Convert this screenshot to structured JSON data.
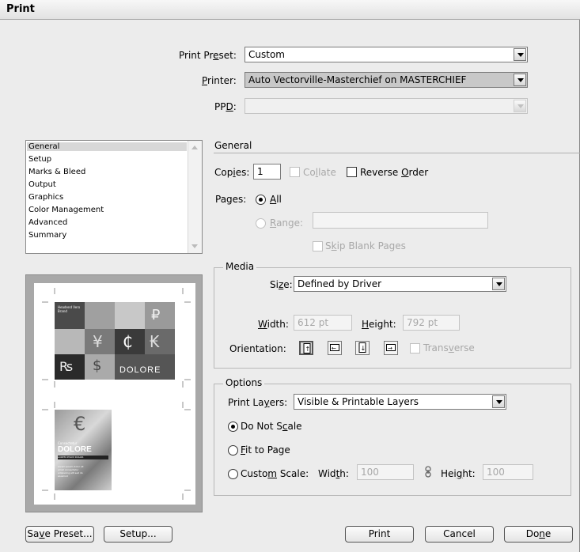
{
  "window": {
    "title": "Print"
  },
  "preset": {
    "label_pre": "Print Pr",
    "label_key": "e",
    "label_post": "set:",
    "value": "Custom"
  },
  "printer": {
    "label_key": "P",
    "label_post": "rinter:",
    "value": "Auto Vectorville-Masterchief on MASTERCHIEF"
  },
  "ppd": {
    "label_pre": "PP",
    "label_key": "D",
    "label_post": ":",
    "value": ""
  },
  "categories": {
    "items": [
      "General",
      "Setup",
      "Marks & Bleed",
      "Output",
      "Graphics",
      "Color Management",
      "Advanced",
      "Summary"
    ],
    "selected": "General"
  },
  "section": {
    "title": "General"
  },
  "copies": {
    "label_pre": "Cop",
    "label_key": "i",
    "label_post": "es:",
    "value": "1"
  },
  "collate": {
    "pre": "Co",
    "key": "l",
    "post": "late",
    "checked": false,
    "enabled": false
  },
  "reverse_order": {
    "pre": "Reverse ",
    "key": "O",
    "post": "rder",
    "checked": false
  },
  "pages": {
    "label": "Pages:",
    "all_key": "A",
    "all_post": "ll",
    "range_key": "R",
    "range_post": "ange:",
    "range_value": "",
    "selected": "All",
    "skip_pre": "S",
    "skip_key": "k",
    "skip_post": "ip Blank Pages"
  },
  "media": {
    "group": "Media",
    "size_pre": "Si",
    "size_key": "z",
    "size_post": "e:",
    "size_value": "Defined by Driver",
    "width_key": "W",
    "width_post": "idth:",
    "width_value": "612 pt",
    "height_key": "H",
    "height_post": "eight:",
    "height_value": "792 pt",
    "orientation_label": "Orientation:",
    "transverse_pre": "Trans",
    "transverse_key": "v",
    "transverse_post": "erse"
  },
  "options": {
    "group": "Options",
    "layers_pre": "Print La",
    "layers_key": "y",
    "layers_post": "ers:",
    "layers_value": "Visible & Printable Layers",
    "no_scale_pre": "Do Not S",
    "no_scale_key": "c",
    "no_scale_post": "ale",
    "fit_key": "F",
    "fit_post": "it to Page",
    "custom_pre": "Custo",
    "custom_key": "m",
    "custom_post": " Scale:",
    "width_pre": "Wid",
    "width_key": "t",
    "width_post": "h:",
    "width_value": "100",
    "height_pre": "Hei",
    "height_key": "g",
    "height_post": "ht:",
    "height_value": "100",
    "scale_mode": "Do Not Scale"
  },
  "preview": {
    "top_text": "Headend Vero Brand",
    "top_word": "DOLORE",
    "bottom_small": "Consectetur",
    "bottom_word": "DOLORE",
    "bottom_caption": "LOREM IPSUM DOLOR",
    "bottom_body": "Lorem ipsum dolor sit amet consectetur adipiscing elit sed do eiusmod",
    "symbols": [
      "₽",
      "¥",
      "₵",
      "₭",
      "₨",
      "$",
      "€"
    ]
  },
  "buttons": {
    "save_preset_pre": "Sa",
    "save_preset_key": "v",
    "save_preset_post": "e Preset...",
    "setup": "Setup...",
    "print": "Print",
    "cancel": "Cancel",
    "done_pre": "Do",
    "done_key": "n",
    "done_post": "e"
  }
}
